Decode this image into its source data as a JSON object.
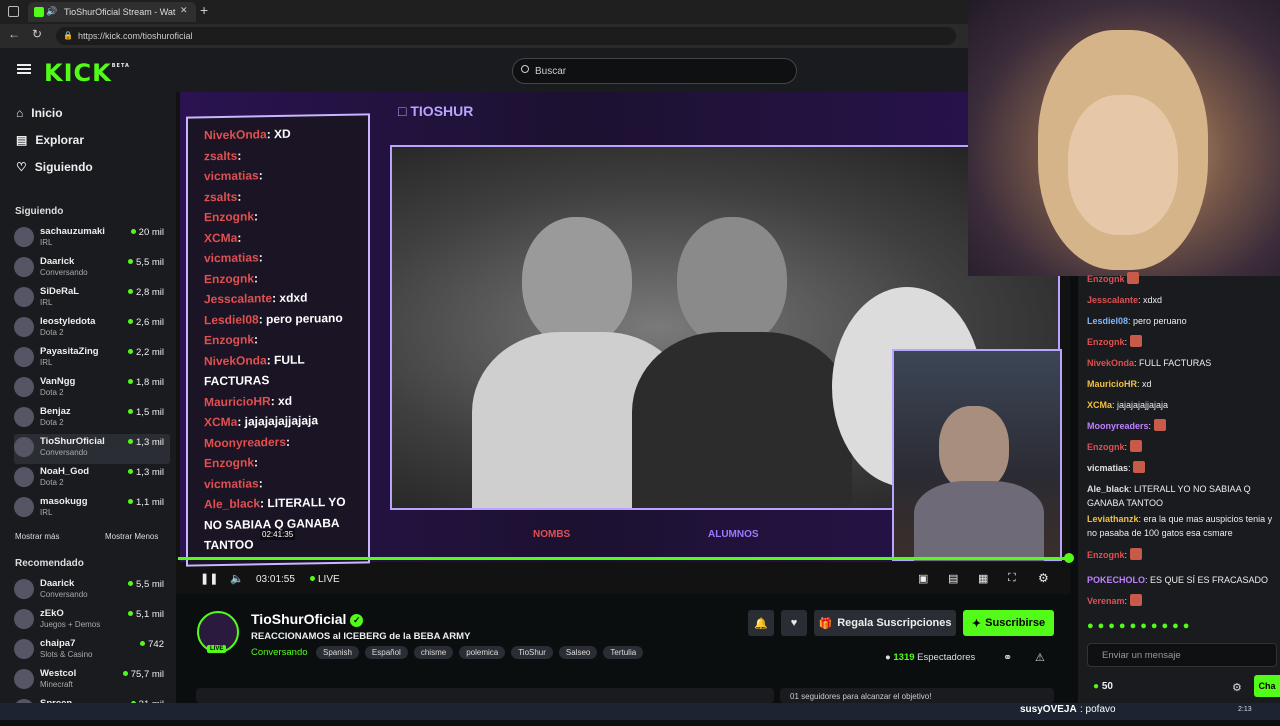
{
  "browser": {
    "tab_title": "TioShurOficial Stream - Wat",
    "close_tab": "✕",
    "new_tab": "+",
    "url": "https://kick.com/tioshuroficial"
  },
  "header": {
    "logo": "KICK",
    "logo_badge": "BETA",
    "search_placeholder": "Buscar"
  },
  "sidebar": {
    "nav": [
      {
        "label": "Inicio",
        "icon": "home-icon"
      },
      {
        "label": "Explorar",
        "icon": "browse-icon"
      },
      {
        "label": "Siguiendo",
        "icon": "heart-icon"
      }
    ],
    "following_title": "Siguiendo",
    "following": [
      {
        "name": "sachauzumaki",
        "category": "IRL",
        "viewers": "20 mil"
      },
      {
        "name": "Daarick",
        "category": "Conversando",
        "viewers": "5,5 mil"
      },
      {
        "name": "SiDeRaL",
        "category": "IRL",
        "viewers": "2,8 mil"
      },
      {
        "name": "leostyledota",
        "category": "Dota 2",
        "viewers": "2,6 mil"
      },
      {
        "name": "PayasitaZing",
        "category": "IRL",
        "viewers": "2,2 mil"
      },
      {
        "name": "VanNgg",
        "category": "Dota 2",
        "viewers": "1,8 mil"
      },
      {
        "name": "Benjaz",
        "category": "Dota 2",
        "viewers": "1,5 mil"
      },
      {
        "name": "TioShurOficial",
        "category": "Conversando",
        "viewers": "1,3 mil"
      },
      {
        "name": "NoaH_God",
        "category": "Dota 2",
        "viewers": "1,3 mil"
      },
      {
        "name": "masokugg",
        "category": "IRL",
        "viewers": "1,1 mil"
      }
    ],
    "show_more": "Mostrar más",
    "show_less": "Mostrar Menos",
    "recommended_title": "Recomendado",
    "recommended": [
      {
        "name": "Daarick",
        "category": "Conversando",
        "viewers": "5,5 mil"
      },
      {
        "name": "zEkO",
        "category": "Juegos + Demos",
        "viewers": "5,1 mil"
      },
      {
        "name": "chaipa7",
        "category": "Slots & Casino",
        "viewers": "742"
      },
      {
        "name": "Westcol",
        "category": "Minecraft",
        "viewers": "75,7 mil"
      },
      {
        "name": "Spreen",
        "category": "",
        "viewers": "31 mil"
      }
    ]
  },
  "player": {
    "overlay_brand": "TIOSHUR",
    "overlay_chat": [
      {
        "user": "NivekOnda",
        "text": ": XD"
      },
      {
        "user": "zsalts",
        "text": ":"
      },
      {
        "user": "vicmatias",
        "text": ":"
      },
      {
        "user": "zsalts",
        "text": ":"
      },
      {
        "user": "Enzognk",
        "text": ":"
      },
      {
        "user": "XCMa",
        "text": ":"
      },
      {
        "user": "vicmatias",
        "text": ":"
      },
      {
        "user": "Enzognk",
        "text": ":"
      },
      {
        "user": "Jesscalante",
        "text": ": xdxd"
      },
      {
        "user": "Lesdiel08",
        "text": ": pero peruano"
      },
      {
        "user": "Enzognk",
        "text": ":"
      },
      {
        "user": "NivekOnda",
        "text": ": FULL"
      },
      {
        "user": "",
        "text": "FACTURAS"
      },
      {
        "user": "MauricioHR",
        "text": ": xd"
      },
      {
        "user": "XCMa",
        "text": ": jajajajajjajaja"
      },
      {
        "user": "Moonyreaders",
        "text": ":"
      },
      {
        "user": "Enzognk",
        "text": ":"
      },
      {
        "user": "vicmatias",
        "text": ":"
      },
      {
        "user": "Ale_black",
        "text": ": LITERALL YO"
      },
      {
        "user": "",
        "text": "NO SABIAA Q GANABA"
      },
      {
        "user": "",
        "text": "TANTOO"
      }
    ],
    "bottom_labels": [
      "NOMBS",
      "ALUMNOS"
    ],
    "hover_time": "02:41:35",
    "elapsed": "03:01:55",
    "live_label": "LIVE",
    "progress": 1.0,
    "accent": "#53fc18"
  },
  "stream": {
    "channel": "TioShurOficial",
    "title": "REACCIONAMOS al ICEBERG de la BEBA ARMY",
    "category": "Conversando",
    "tags": [
      "Spanish",
      "Español",
      "chisme",
      "polemica",
      "TioShur",
      "Salseo",
      "Tertulia"
    ],
    "live_badge": "LIVE",
    "gift_label": "Regala Suscripciones",
    "subscribe_label": "Suscribirse",
    "viewers": "1319",
    "viewers_label": "Espectadores",
    "below_text": "01 seguidores para alcanzar el objetivo!"
  },
  "chat": {
    "messages": [
      {
        "user": "Enzognk",
        "color": "#e05050",
        "text": "",
        "emote": true
      },
      {
        "user": "Jesscalante",
        "color": "#e05050",
        "text": ": xdxd",
        "emote": false
      },
      {
        "user": "Lesdiel08",
        "color": "#7fb8ff",
        "text": ": pero peruano",
        "emote": false
      },
      {
        "user": "Enzognk",
        "color": "#e05050",
        "text": ":",
        "emote": true
      },
      {
        "user": "NivekOnda",
        "color": "#e05050",
        "text": ": FULL FACTURAS",
        "emote": false
      },
      {
        "user": "MauricioHR",
        "color": "#f0c040",
        "text": ": xd",
        "emote": false
      },
      {
        "user": "XCMa",
        "color": "#f0c040",
        "text": ": jajajajajjajaja",
        "emote": false
      },
      {
        "user": "Moonyreaders",
        "color": "#c080ff",
        "text": ":",
        "emote": true
      },
      {
        "user": "Enzognk",
        "color": "#e05050",
        "text": ":",
        "emote": true
      },
      {
        "user": "vicmatias",
        "color": "#e0e0e0",
        "text": ":",
        "emote": true
      },
      {
        "user": "Ale_black",
        "color": "#e0e0e0",
        "text": ": LITERALL YO NO SABIAA Q GANABA TANTOO",
        "emote": false
      },
      {
        "user": "Leviathanzk",
        "color": "#f0c040",
        "text": ": era la que mas auspicios tenia y no pasaba de 100 gatos esa csmare",
        "emote": false
      },
      {
        "user": "Enzognk",
        "color": "#e05050",
        "text": ":",
        "emote": true
      },
      {
        "user": "POKECHOLO",
        "color": "#c080ff",
        "text": ": ES QUE SÍ ES FRACASADO",
        "emote": false
      },
      {
        "user": "Verenam",
        "color": "#e05050",
        "text": ":",
        "emote": true
      }
    ],
    "input_placeholder": "Enviar un mensaje",
    "points": "50",
    "send_label": "Cha",
    "bottom_user": "susyOVEJA",
    "bottom_text": ": pofavo"
  },
  "taskbar": {
    "time": "2:13"
  }
}
